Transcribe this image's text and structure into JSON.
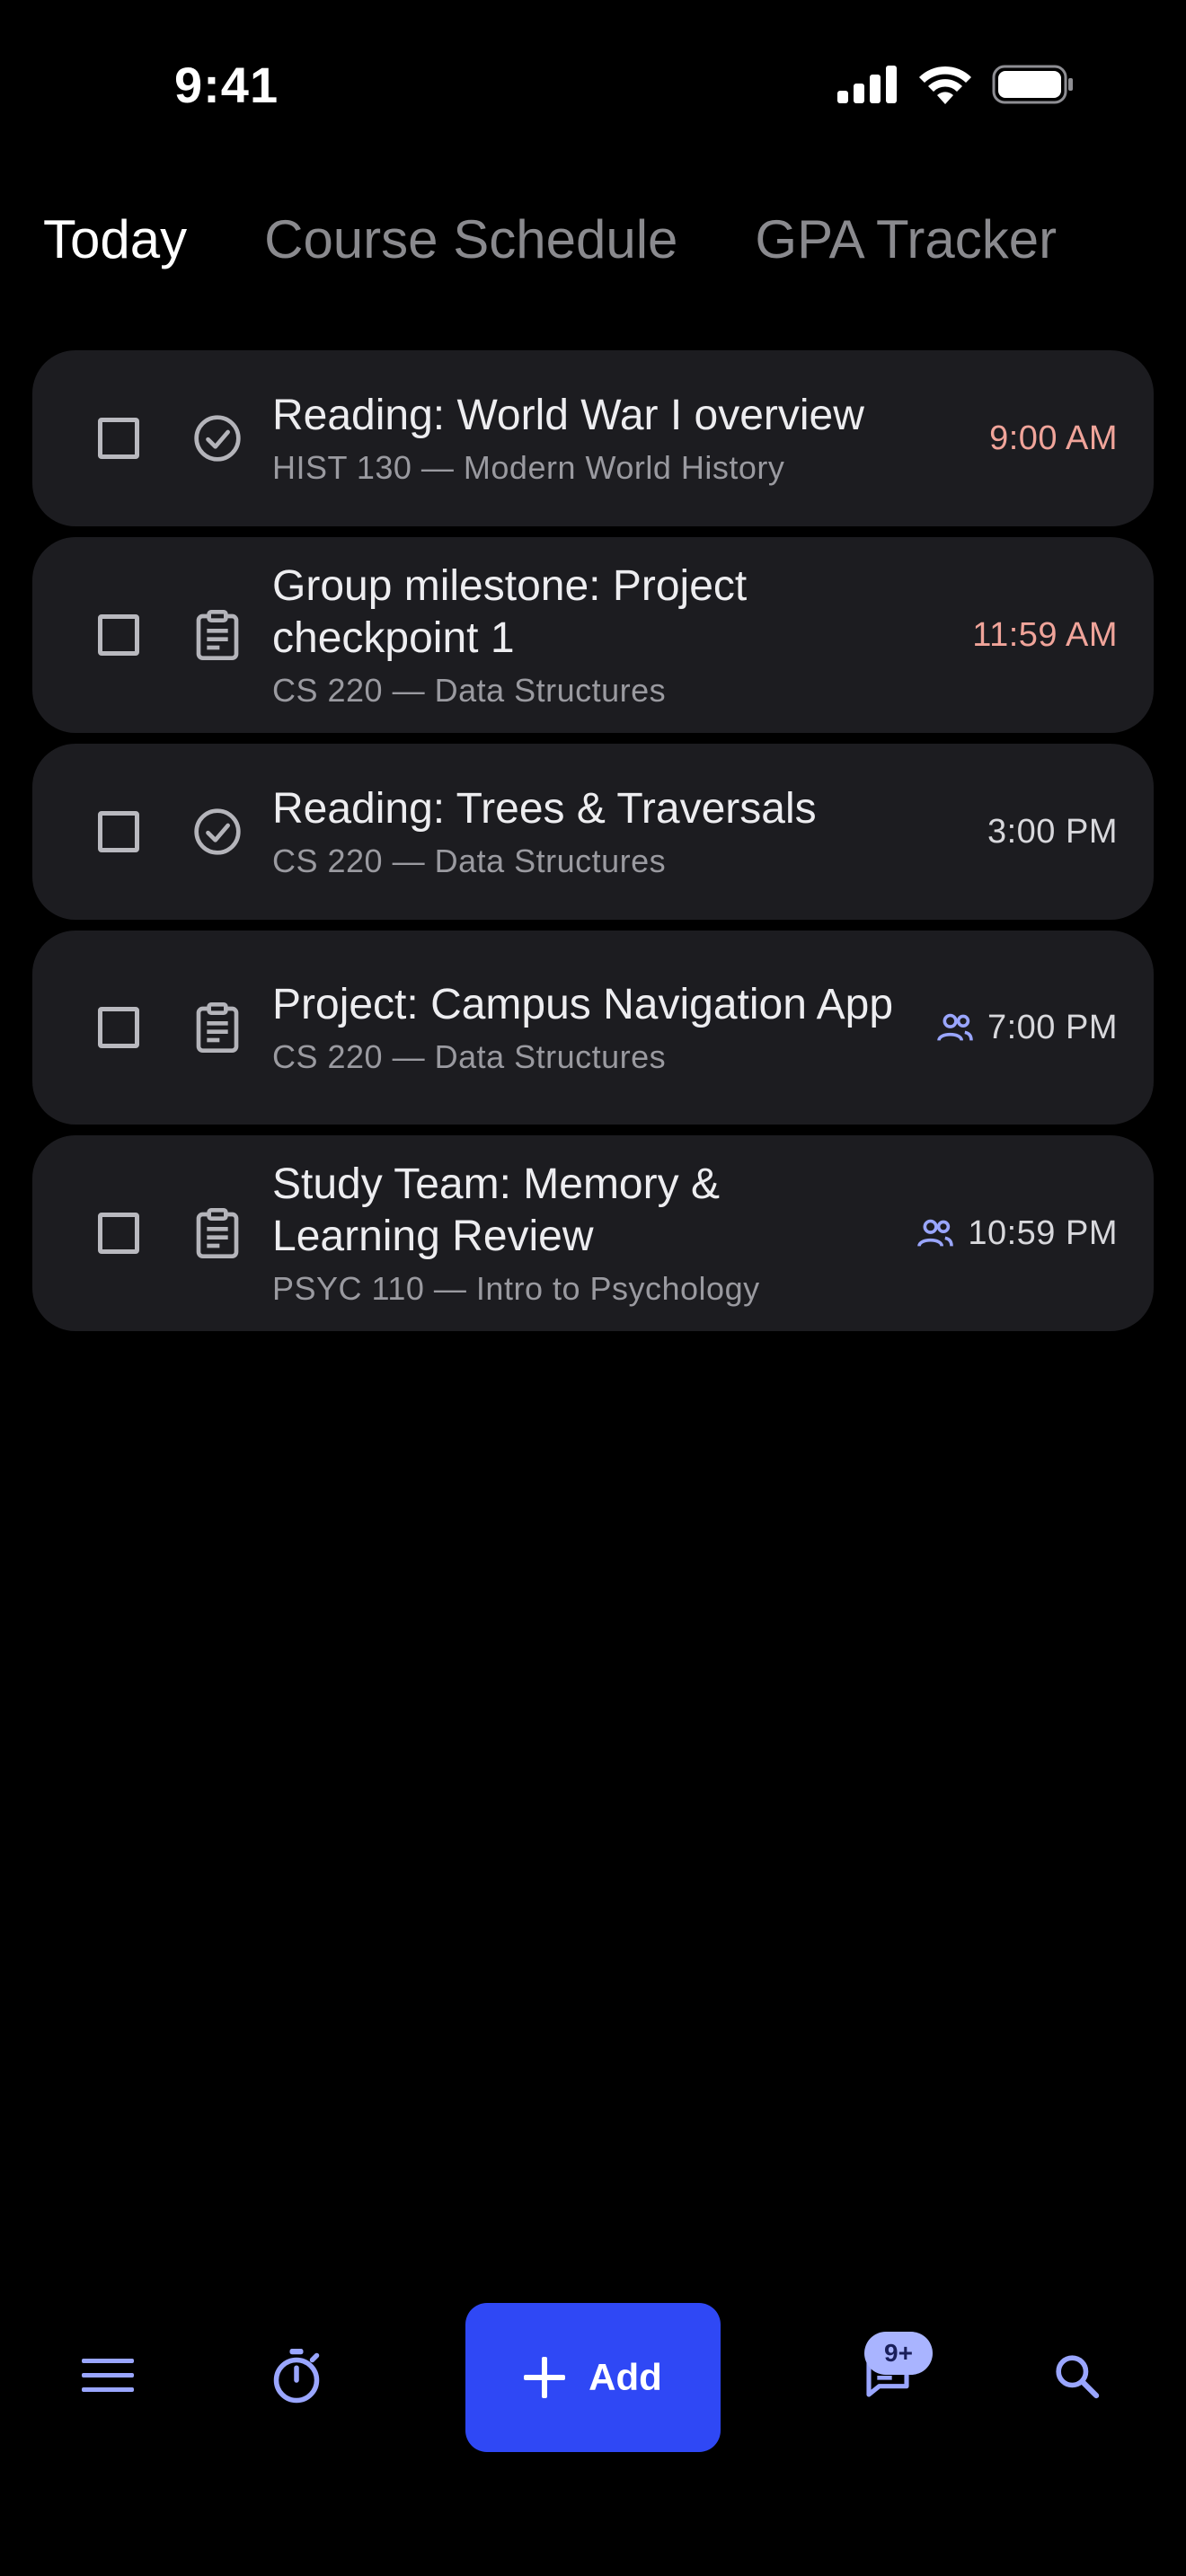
{
  "status_bar": {
    "time": "9:41"
  },
  "tabs": [
    {
      "label": "Today",
      "active": true
    },
    {
      "label": "Course Schedule",
      "active": false
    },
    {
      "label": "GPA Tracker",
      "active": false
    }
  ],
  "tasks": [
    {
      "icon": "check-circle-icon",
      "title": "Reading: World War I overview",
      "subtitle": "HIST 130 — Modern World History",
      "time": "9:00 AM",
      "due": true,
      "group": false
    },
    {
      "icon": "clipboard-icon",
      "title": "Group milestone: Project checkpoint 1",
      "subtitle": "CS 220 — Data Structures",
      "time": "11:59 AM",
      "due": true,
      "group": false
    },
    {
      "icon": "check-circle-icon",
      "title": "Reading: Trees & Traversals",
      "subtitle": "CS 220 — Data Structures",
      "time": "3:00 PM",
      "due": false,
      "group": false
    },
    {
      "icon": "clipboard-icon",
      "title": "Project: Campus Navigation App",
      "subtitle": "CS 220 — Data Structures",
      "time": "7:00 PM",
      "due": false,
      "group": true
    },
    {
      "icon": "clipboard-icon",
      "title": "Study Team: Memory & Learning Review",
      "subtitle": "PSYC 110 — Intro to Psychology",
      "time": "10:59 PM",
      "due": false,
      "group": true
    }
  ],
  "bottom_nav": {
    "add_label": "Add",
    "messages_badge": "9+",
    "icons": [
      "menu-icon",
      "timer-icon",
      "plus-icon",
      "chat-icon",
      "search-icon"
    ]
  },
  "colors": {
    "background": "#000000",
    "card": "#1c1c20",
    "accent": "#2f48f5",
    "due_time": "#f0a49a",
    "nav_icon": "#9aa6ff",
    "badge": "#a9b4ff"
  }
}
